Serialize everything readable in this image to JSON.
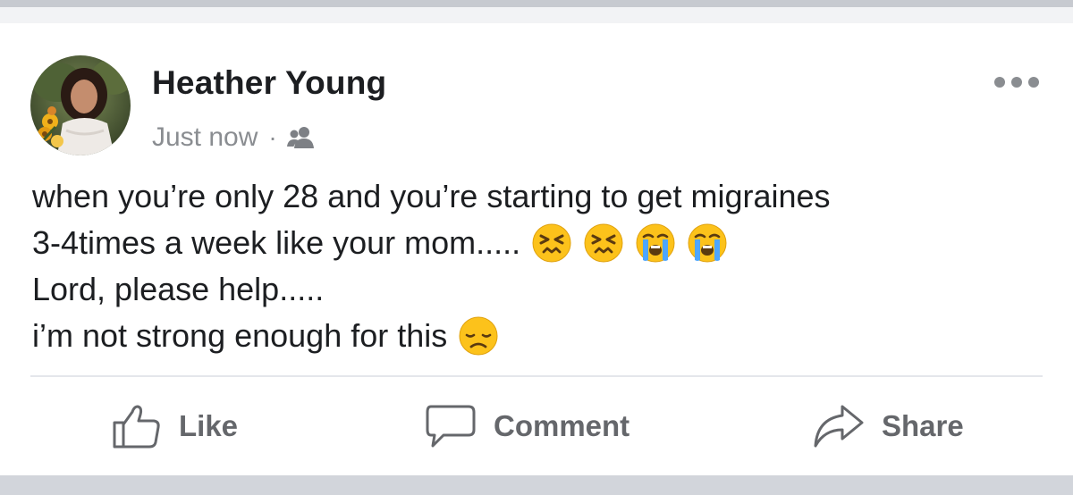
{
  "post": {
    "author_name": "Heather Young",
    "timestamp": "Just now",
    "separator": "·",
    "audience_icon": "friends-icon",
    "more_icon": "more-options-icon",
    "lines": [
      "when you’re only 28 and you’re starting to get migraines",
      "3-4times a week like your mom.....",
      "Lord, please help.....",
      "i’m not strong enough for this"
    ],
    "line2_emojis": [
      "persevering-face",
      "persevering-face",
      "loudly-crying-face",
      "loudly-crying-face"
    ],
    "line4_emojis": [
      "disappointed-face"
    ]
  },
  "actions": {
    "like_label": "Like",
    "comment_label": "Comment",
    "share_label": "Share"
  },
  "colors": {
    "name_text": "#1c1e21",
    "meta_text": "#8a8d91",
    "action_text": "#65676b",
    "divider": "#e4e6eb",
    "page_background": "#cdd0d6",
    "emoji_yellow": "#fcc21b"
  }
}
